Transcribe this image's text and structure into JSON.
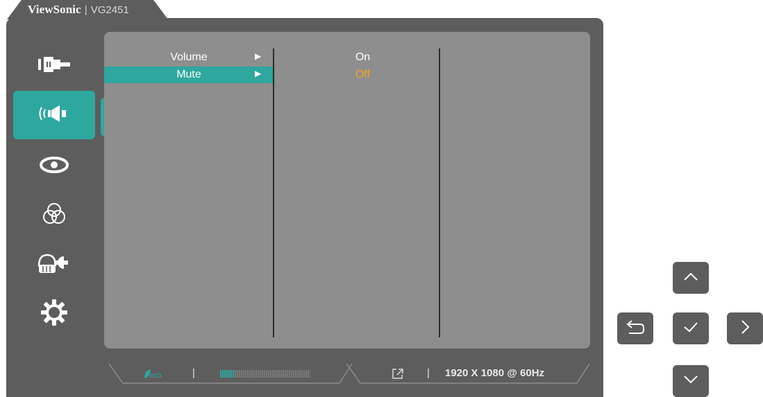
{
  "brand": {
    "name": "ViewSonic",
    "separator": "|",
    "model": "VG2451"
  },
  "sidebar": {
    "items": [
      {
        "name": "input-select",
        "icon": "input-icon",
        "active": false
      },
      {
        "name": "audio-adjust",
        "icon": "speaker-icon",
        "active": true
      },
      {
        "name": "viewmode",
        "icon": "eye-icon",
        "active": false
      },
      {
        "name": "color-adjust",
        "icon": "color-circles-icon",
        "active": false
      },
      {
        "name": "manual-image-adjust",
        "icon": "hand-wrench-icon",
        "active": false
      },
      {
        "name": "setup-menu",
        "icon": "gear-icon",
        "active": false
      }
    ]
  },
  "submenu": {
    "items": [
      {
        "label": "Volume",
        "arrow": "▶",
        "selected": false
      },
      {
        "label": "Mute",
        "arrow": "▶",
        "selected": true
      }
    ]
  },
  "options": {
    "items": [
      {
        "label": "On",
        "highlighted": false
      },
      {
        "label": "Off",
        "highlighted": true
      }
    ]
  },
  "status": {
    "eco_label": "eco",
    "separator": "|",
    "resolution": "1920 X 1080 @ 60Hz",
    "eco_level": 0.16
  },
  "colors": {
    "accent": "#2ea79f",
    "highlight_text": "#f5a623",
    "panel": "#8f8e8e",
    "frame": "#5d5d5d"
  },
  "nav_buttons": [
    {
      "name": "up",
      "icon": "chevron-up-icon"
    },
    {
      "name": "back",
      "icon": "return-icon"
    },
    {
      "name": "ok",
      "icon": "checkmark-icon"
    },
    {
      "name": "right",
      "icon": "chevron-right-icon"
    },
    {
      "name": "down",
      "icon": "chevron-down-icon"
    }
  ]
}
